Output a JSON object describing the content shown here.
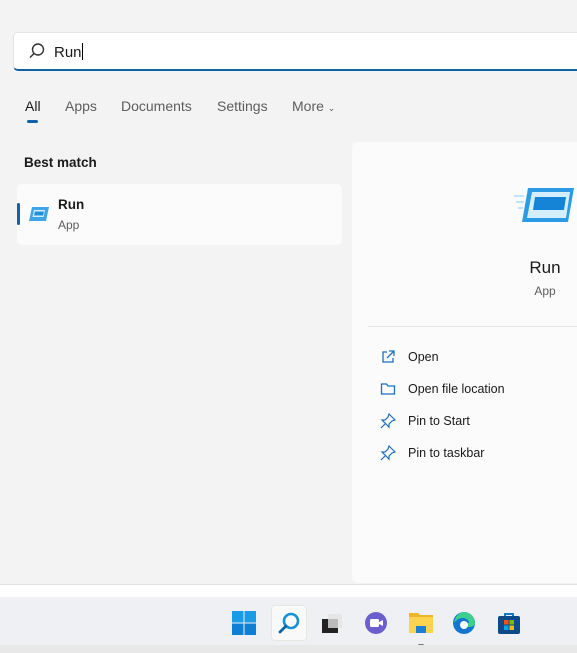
{
  "search": {
    "value": "Run",
    "icon": "search-icon"
  },
  "tabs": [
    {
      "label": "All",
      "active": true
    },
    {
      "label": "Apps"
    },
    {
      "label": "Documents"
    },
    {
      "label": "Settings"
    },
    {
      "label": "More"
    }
  ],
  "best_match": {
    "heading": "Best match",
    "name": "Run",
    "type": "App",
    "icon": "run-app-icon"
  },
  "details": {
    "name": "Run",
    "type": "App",
    "actions": [
      {
        "label": "Open",
        "icon": "open-external-icon"
      },
      {
        "label": "Open file location",
        "icon": "folder-icon"
      },
      {
        "label": "Pin to Start",
        "icon": "pin-icon"
      },
      {
        "label": "Pin to taskbar",
        "icon": "pin-icon"
      }
    ]
  },
  "taskbar": {
    "items": [
      "start",
      "search",
      "task-view",
      "teams-chat",
      "file-explorer",
      "edge",
      "microsoft-store"
    ]
  },
  "colors": {
    "accent": "#0f62a8"
  }
}
